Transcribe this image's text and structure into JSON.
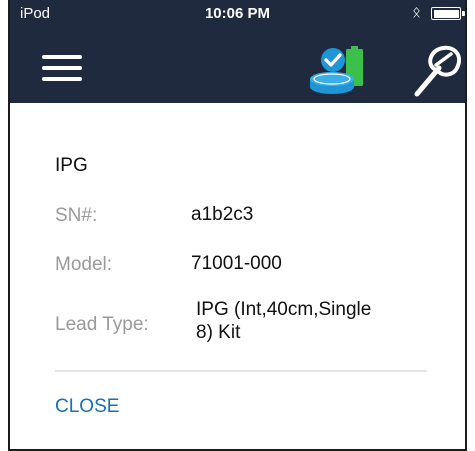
{
  "status_bar": {
    "carrier": "iPod",
    "time": "10:06 PM",
    "bluetooth_icon": "bluetooth-icon",
    "battery_icon": "battery-full-icon"
  },
  "nav_bar": {
    "background_color": "#1f2a3e",
    "menu_icon": "hamburger-menu-icon",
    "device_status_icon": "ipg-connected-battery-icon",
    "wand_icon": "programmer-wand-icon"
  },
  "dialog": {
    "title": "IPG",
    "rows": [
      {
        "label": "SN#:",
        "value": "a1b2c3"
      },
      {
        "label": "Model:",
        "value": "71001-000"
      },
      {
        "label": "Lead Type:",
        "value_line1": "IPG (Int,40cm,Single",
        "value_line2": "8) Kit"
      }
    ],
    "close_label": "CLOSE",
    "accent_color": "#1a6fb5"
  }
}
